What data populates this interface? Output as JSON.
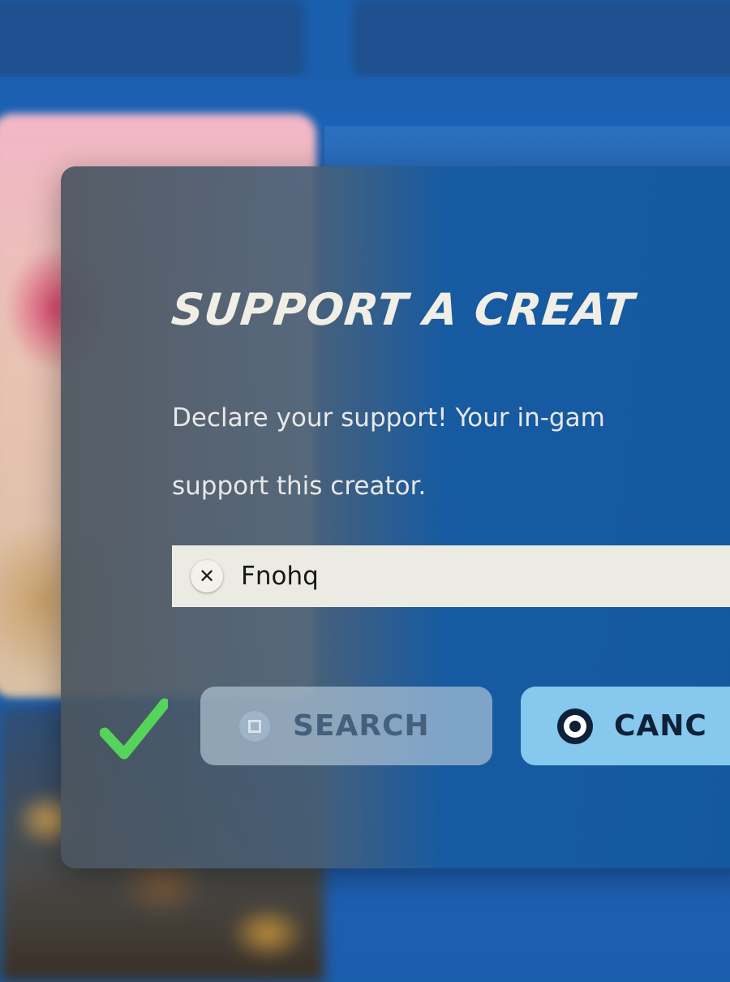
{
  "dialog": {
    "title": "SUPPORT A CREAT",
    "description": "Declare your support! Your in-gam\nsupport this creator.",
    "search_field": {
      "value": "Fnohq",
      "clear_icon": "close-icon",
      "clear_glyph": "✕"
    },
    "confirm_icon": "checkmark-icon",
    "buttons": {
      "search": {
        "label": "SEARCH",
        "icon": "square-button-icon"
      },
      "cancel": {
        "label": "CANC",
        "icon": "circle-button-icon"
      }
    }
  },
  "colors": {
    "checkmark": "#55d35a",
    "cancel_button": "#86c8ee",
    "search_button_disabled": "#becfe0",
    "background": "#1a5fae"
  }
}
